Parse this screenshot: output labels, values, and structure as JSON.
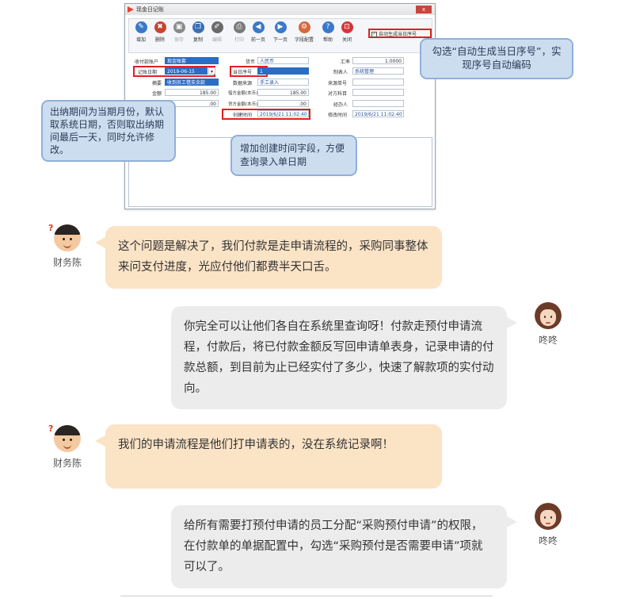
{
  "window": {
    "title": "现金日记账",
    "close_label": "x"
  },
  "toolbar": {
    "buttons": [
      {
        "label": "增加",
        "color": "#3a78c9",
        "icon": "pencil-icon"
      },
      {
        "label": "删除",
        "color": "#c8442f",
        "icon": "delete-icon"
      },
      {
        "label": "保存",
        "color": "#8a8a8a",
        "icon": "save-icon"
      },
      {
        "label": "复制",
        "color": "#3b6fb5",
        "icon": "copy-icon"
      },
      {
        "label": "编辑",
        "color": "#6a6a6a",
        "icon": "edit-icon"
      },
      {
        "label": "打印",
        "color": "#7a7a7a",
        "icon": "print-icon"
      },
      {
        "label": "前一页",
        "color": "#3a78c9",
        "icon": "prev-icon"
      },
      {
        "label": "下一页",
        "color": "#3a78c9",
        "icon": "next-icon"
      },
      {
        "label": "字段配置",
        "color": "#d9683b",
        "icon": "gear-icon"
      },
      {
        "label": "帮助",
        "color": "#3a78c9",
        "icon": "help-icon"
      },
      {
        "label": "关闭",
        "color": "#d4353a",
        "icon": "close-icon"
      }
    ],
    "auto_checkbox_label": "自动生成当日序号",
    "auto_checkbox_checked": "✓"
  },
  "form": {
    "account_label": "收付款账户",
    "account_value": "现金账套",
    "currency_label": "货币",
    "currency_value": "人民币",
    "rate_label": "汇率",
    "rate_value": "1.0000",
    "date_label": "记账日期",
    "date_value": "2019-06-15",
    "seq_label": "当日序号",
    "seq_value": "1",
    "maker_label": "制表人",
    "maker_value": "系统管理",
    "summary_label": "摘要",
    "summary_value": "收到员工借支余款",
    "source_label": "数据来源",
    "source_value": "手工录入",
    "source_no_label": "来源单号",
    "amount_label": "金额",
    "amount_value": "185.00",
    "debit_label": "借方金额(本币)",
    "debit_value": "185.00",
    "subject_label": "对方科目",
    "row4_value": ".00",
    "credit_label": "贷方金额(本币)",
    "credit_value": ".00",
    "handler_label": "经办人",
    "created_label": "创建时间",
    "created_value": "2019/6/21 11:02:40",
    "modified_label": "修改时间",
    "modified_value": "2019/6/21 11:02:40"
  },
  "callouts": {
    "right": "勾选“自动生成当日序号”，实现序号自动编码",
    "left": "出纳期间为当期月份，默认取系统日期，否则取出纳期间最后一天，同时允许修改。",
    "bottom": "增加创建时间字段，方便查询录入单日期"
  },
  "chat": {
    "finance_name": "财务陈",
    "dongdong_name": "咚咚",
    "msg1": "这个问题是解决了，我们付款是走申请流程的，采购同事整体来问支付进度，光应付他们都费半天口舌。",
    "msg2": "你完全可以让他们各自在系统里查询呀！付款走预付申请流程，付款后，将已付款金额反写回申请单表身，记录申请的付款总额，到目前为止已经实付了多少，快速了解款项的实付动向。",
    "msg3": "我们的申请流程是他们打申请表的，没在系统记录啊！",
    "msg4": "给所有需要打预付申请的员工分配“采购预付申请”的权限，在付款单的单据配置中，勾选“采购预付是否需要申请”项就可以了。"
  }
}
